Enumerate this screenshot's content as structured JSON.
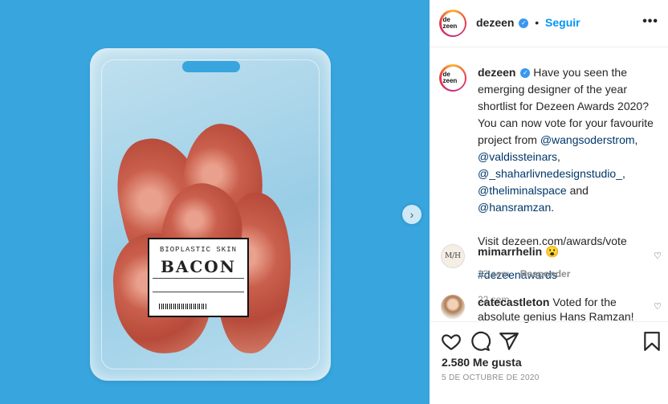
{
  "post": {
    "image_label_title": "BIOPLASTIC SKIN",
    "image_label_big": "BACON"
  },
  "header": {
    "avatar_text": "de zeen",
    "username": "dezeen",
    "separator": "•",
    "follow_label": "Seguir",
    "more_label": "•••"
  },
  "caption": {
    "username": "dezeen",
    "text_before": "Have you seen the emerging designer of the year shortlist for Dezeen Awards 2020? You can now vote for your favourite project from",
    "mention1": "@wangsoderstrom",
    "comma1": ",",
    "mention2": "@valdissteinars",
    "comma2": ",",
    "mention3": "@_shaharlivnedesignstudio_",
    "comma3": ",",
    "mention4": "@theliminalspace",
    "and_text": "and",
    "mention5": "@hansramzan",
    "period": ".",
    "visit_text": "Visit dezeen.com/awards/vote",
    "hashtag": "#dezeenawards",
    "time": "22 sem"
  },
  "comments": [
    {
      "username": "mimarrhelin",
      "text": "😮",
      "avatar_text": "M/H",
      "time": "22 sem",
      "reply_label": "Responder"
    },
    {
      "username": "catecastleton",
      "text": "Voted for the absolute genius Hans Ramzan!"
    }
  ],
  "footer": {
    "likes": "2.580 Me gusta",
    "date": "5 DE OCTUBRE DE 2020"
  },
  "colors": {
    "photo_background": "#38a5de",
    "link": "#0095f6",
    "mention": "#00376b",
    "muted": "#8e8e8e"
  },
  "icons": [
    "chevron-right-icon",
    "verified-icon",
    "more-icon",
    "heart-icon",
    "comment-icon",
    "share-icon",
    "bookmark-icon"
  ]
}
